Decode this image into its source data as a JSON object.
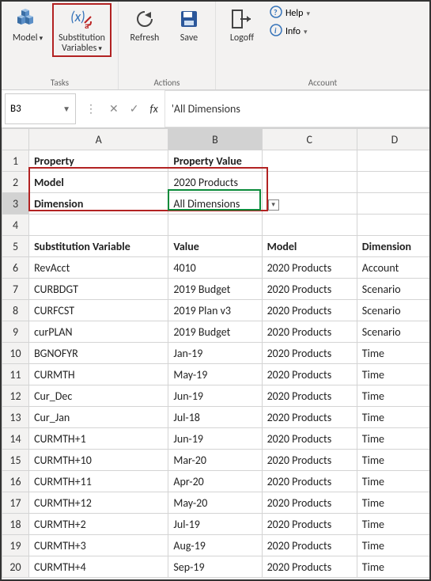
{
  "ribbon": {
    "groups": {
      "tasks": {
        "label": "Tasks",
        "model_btn": "Model",
        "subvar_btn_line1": "Substitution",
        "subvar_btn_line2": "Variables"
      },
      "actions": {
        "label": "Actions",
        "refresh": "Refresh",
        "save": "Save"
      },
      "account": {
        "label": "Account",
        "logoff": "Logoff",
        "help": "Help",
        "info": "Info"
      }
    }
  },
  "formula_bar": {
    "namebox_value": "B3",
    "fx_label": "fx",
    "formula_text": "'All Dimensions"
  },
  "columns": [
    "A",
    "B",
    "C",
    "D"
  ],
  "property_header": {
    "prop": "Property",
    "val": "Property Value"
  },
  "property_rows": [
    {
      "k": "Model",
      "v": "2020 Products"
    },
    {
      "k": "Dimension",
      "v": "All Dimensions"
    }
  ],
  "table_header": {
    "a": "Substitution Variable",
    "b": "Value",
    "c": "Model",
    "d": "Dimension"
  },
  "rows": [
    {
      "a": "RevAcct",
      "b": "4010",
      "c": "2020 Products",
      "d": "Account",
      "gray": false
    },
    {
      "a": "CURBDGT",
      "b": "2019 Budget",
      "c": "2020 Products",
      "d": "Scenario",
      "gray": false
    },
    {
      "a": "CURFCST",
      "b": "2019 Plan v3",
      "c": "2020 Products",
      "d": "Scenario",
      "gray": false
    },
    {
      "a": "curPLAN",
      "b": "2019 Budget",
      "c": "2020 Products",
      "d": "Scenario",
      "gray": false
    },
    {
      "a": "BGNOFYR",
      "b": "Jan-19",
      "c": "2020 Products",
      "d": "Time",
      "gray": false
    },
    {
      "a": "CURMTH",
      "b": "May-19",
      "c": "2020 Products",
      "d": "Time",
      "gray": false
    },
    {
      "a": "Cur_Dec",
      "b": "Jun-19",
      "c": "2020 Products",
      "d": "Time",
      "gray": true
    },
    {
      "a": "Cur_Jan",
      "b": "Jul-18",
      "c": "2020 Products",
      "d": "Time",
      "gray": true
    },
    {
      "a": "CURMTH+1",
      "b": "Jun-19",
      "c": "2020 Products",
      "d": "Time",
      "gray": true
    },
    {
      "a": "CURMTH+10",
      "b": "Mar-20",
      "c": "2020 Products",
      "d": "Time",
      "gray": true
    },
    {
      "a": "CURMTH+11",
      "b": "Apr-20",
      "c": "2020 Products",
      "d": "Time",
      "gray": true
    },
    {
      "a": "CURMTH+12",
      "b": "May-20",
      "c": "2020 Products",
      "d": "Time",
      "gray": true
    },
    {
      "a": "CURMTH+2",
      "b": "Jul-19",
      "c": "2020 Products",
      "d": "Time",
      "gray": true
    },
    {
      "a": "CURMTH+3",
      "b": "Aug-19",
      "c": "2020 Products",
      "d": "Time",
      "gray": true
    },
    {
      "a": "CURMTH+4",
      "b": "Sep-19",
      "c": "2020 Products",
      "d": "Time",
      "gray": true
    }
  ],
  "chart_data": {
    "type": "table",
    "title": "Substitution Variables",
    "columns": [
      "Substitution Variable",
      "Value",
      "Model",
      "Dimension"
    ],
    "rows": [
      [
        "RevAcct",
        "4010",
        "2020 Products",
        "Account"
      ],
      [
        "CURBDGT",
        "2019 Budget",
        "2020 Products",
        "Scenario"
      ],
      [
        "CURFCST",
        "2019 Plan v3",
        "2020 Products",
        "Scenario"
      ],
      [
        "curPLAN",
        "2019 Budget",
        "2020 Products",
        "Scenario"
      ],
      [
        "BGNOFYR",
        "Jan-19",
        "2020 Products",
        "Time"
      ],
      [
        "CURMTH",
        "May-19",
        "2020 Products",
        "Time"
      ],
      [
        "Cur_Dec",
        "Jun-19",
        "2020 Products",
        "Time"
      ],
      [
        "Cur_Jan",
        "Jul-18",
        "2020 Products",
        "Time"
      ],
      [
        "CURMTH+1",
        "Jun-19",
        "2020 Products",
        "Time"
      ],
      [
        "CURMTH+10",
        "Mar-20",
        "2020 Products",
        "Time"
      ],
      [
        "CURMTH+11",
        "Apr-20",
        "2020 Products",
        "Time"
      ],
      [
        "CURMTH+12",
        "May-20",
        "2020 Products",
        "Time"
      ],
      [
        "CURMTH+2",
        "Jul-19",
        "2020 Products",
        "Time"
      ],
      [
        "CURMTH+3",
        "Aug-19",
        "2020 Products",
        "Time"
      ],
      [
        "CURMTH+4",
        "Sep-19",
        "2020 Products",
        "Time"
      ]
    ]
  }
}
